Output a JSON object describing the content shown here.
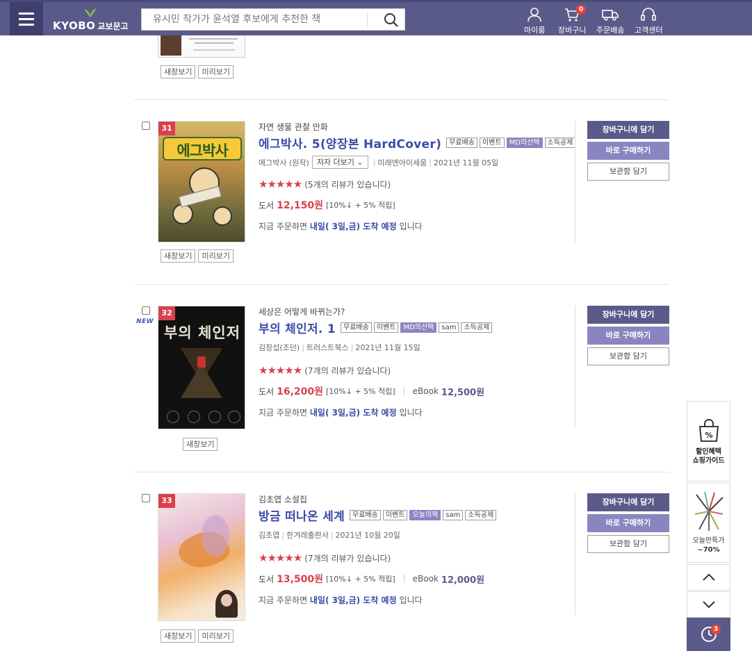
{
  "header": {
    "logo_main": "KYOBO",
    "logo_sub": "교보문고",
    "search_placeholder": "유시민 작가가 윤석열 후보에게 추천한 책",
    "nav": [
      {
        "label": "마이룸",
        "icon": "person-icon"
      },
      {
        "label": "장바구니",
        "icon": "cart-icon",
        "badge": "0"
      },
      {
        "label": "주문배송",
        "icon": "truck-icon"
      },
      {
        "label": "고객센터",
        "icon": "headset-icon"
      }
    ]
  },
  "top_partial": {
    "buttons": [
      "새창보기",
      "미리보기"
    ]
  },
  "items": [
    {
      "rank": "31",
      "subtitle": "자연 생물 관찰 만화",
      "title": "에그박사. 5(양장본 HardCover)",
      "tags": [
        "무료배송",
        "이벤트",
        "MD의선택",
        "소득공제"
      ],
      "author": "에그박사 (원작)",
      "author_more": "저자 더보기",
      "publisher": "미래엔아이세움",
      "date": "2021년 11월 05일",
      "stars": "★★★★★",
      "reviews": "(5개의 리뷰가 있습니다)",
      "price_label": "도서",
      "price": "12,150원",
      "discount": "[10%↓ + 5% 적립]",
      "delivery_prefix": "지금 주문하면",
      "delivery_highlight": "내일( 3일,금) 도착 예정",
      "delivery_suffix": "입니다",
      "cover_buttons": [
        "새창보기",
        "미리보기"
      ],
      "cover_text": "에그박사"
    },
    {
      "rank": "32",
      "new_badge": "NEW",
      "subtitle": "세상은 어떻게 바뀌는가?",
      "title": "부의 체인저. 1",
      "tags": [
        "무료배송",
        "이벤트",
        "MD의선택",
        "sam",
        "소득공제"
      ],
      "author": "김장섭(조던)",
      "publisher": "트러스트북스",
      "date": "2021년 11월 15일",
      "stars": "★★★★★",
      "reviews": "(7개의 리뷰가 있습니다)",
      "price_label": "도서",
      "price": "16,200원",
      "discount": "[10%↓ + 5% 적립]",
      "ebook_label": "eBook",
      "ebook_price": "12,500원",
      "delivery_prefix": "지금 주문하면",
      "delivery_highlight": "내일( 3일,금) 도착 예정",
      "delivery_suffix": "입니다",
      "cover_buttons": [
        "새창보기"
      ],
      "cover_text": "부의 체인저"
    },
    {
      "rank": "33",
      "subtitle": "김초엽 소설집",
      "title": "방금 떠나온 세계",
      "tags": [
        "무료배송",
        "이벤트",
        "오늘의책",
        "sam",
        "소득공제"
      ],
      "author": "김초엽",
      "publisher": "한겨레출판사",
      "date": "2021년 10월 20일",
      "stars": "★★★★★",
      "reviews": "(7개의 리뷰가 있습니다)",
      "price_label": "도서",
      "price": "13,500원",
      "discount": "[10%↓ + 5% 적립]",
      "ebook_label": "eBook",
      "ebook_price": "12,000원",
      "delivery_prefix": "지금 주문하면",
      "delivery_highlight": "내일( 3일,금) 도착 예정",
      "delivery_suffix": "입니다",
      "cover_buttons": [
        "새창보기",
        "미리보기"
      ],
      "cover_text": ""
    }
  ],
  "actions": {
    "cart": "장바구니에 담기",
    "buy": "바로 구매하기",
    "keep": "보관함 담기"
  },
  "floating": {
    "guide_line1": "할인혜택",
    "guide_line2": "쇼핑가이드",
    "sale_line1": "오늘만특가",
    "sale_line2": "~70%",
    "recent_badge": "3"
  },
  "colors": {
    "header_bg": "#5a5a8a",
    "title": "#3b4ba8",
    "price": "#d9404c",
    "buy_button": "#8a85c0"
  }
}
